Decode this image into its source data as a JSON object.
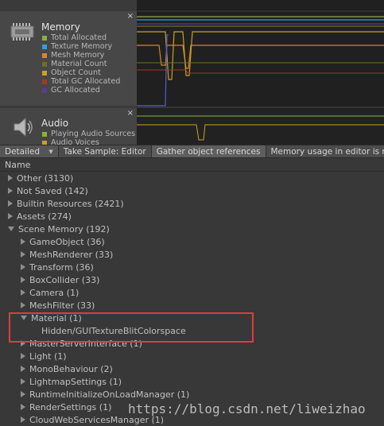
{
  "modules": {
    "memory": {
      "title": "Memory",
      "close": "×",
      "legend": [
        {
          "label": "Total Allocated",
          "color": "#8bb040"
        },
        {
          "label": "Texture Memory",
          "color": "#3a9bd0"
        },
        {
          "label": "Mesh Memory",
          "color": "#d6862a"
        },
        {
          "label": "Material Count",
          "color": "#6e6e2a"
        },
        {
          "label": "Object Count",
          "color": "#c8a21c"
        },
        {
          "label": "Total GC Allocated",
          "color": "#a0382e"
        },
        {
          "label": "GC Allocated",
          "color": "#5a3d8f"
        }
      ]
    },
    "audio": {
      "title": "Audio",
      "close": "×",
      "legend": [
        {
          "label": "Playing Audio Sources",
          "color": "#8bb040"
        },
        {
          "label": "Audio Voices",
          "color": "#c8a21c"
        }
      ]
    }
  },
  "toolbar": {
    "view_mode": "Detailed",
    "take_sample": "Take Sample: Editor",
    "gather_refs": "Gather object references",
    "info": "Memory usage in editor is not"
  },
  "tree": {
    "header": "Name",
    "rows": [
      {
        "label": "Other (3130)",
        "depth": 0,
        "state": "collapsed"
      },
      {
        "label": "Not Saved (142)",
        "depth": 0,
        "state": "collapsed"
      },
      {
        "label": "Builtin Resources (2421)",
        "depth": 0,
        "state": "collapsed"
      },
      {
        "label": "Assets (274)",
        "depth": 0,
        "state": "collapsed"
      },
      {
        "label": "Scene Memory (192)",
        "depth": 0,
        "state": "expanded"
      },
      {
        "label": "GameObject (36)",
        "depth": 1,
        "state": "collapsed"
      },
      {
        "label": "MeshRenderer (33)",
        "depth": 1,
        "state": "collapsed"
      },
      {
        "label": "Transform (36)",
        "depth": 1,
        "state": "collapsed"
      },
      {
        "label": "BoxCollider (33)",
        "depth": 1,
        "state": "collapsed"
      },
      {
        "label": "Camera (1)",
        "depth": 1,
        "state": "collapsed"
      },
      {
        "label": "MeshFilter (33)",
        "depth": 1,
        "state": "collapsed"
      },
      {
        "label": "Material (1)",
        "depth": 1,
        "state": "expanded"
      },
      {
        "label": "Hidden/GUITextureBlitColorspace",
        "depth": 2,
        "state": "leaf"
      },
      {
        "label": "MasterServerInterface (1)",
        "depth": 1,
        "state": "collapsed"
      },
      {
        "label": "Light (1)",
        "depth": 1,
        "state": "collapsed"
      },
      {
        "label": "MonoBehaviour (2)",
        "depth": 1,
        "state": "collapsed"
      },
      {
        "label": "LightmapSettings (1)",
        "depth": 1,
        "state": "collapsed"
      },
      {
        "label": "RuntimeInitializeOnLoadManager (1)",
        "depth": 1,
        "state": "collapsed"
      },
      {
        "label": "RenderSettings (1)",
        "depth": 1,
        "state": "collapsed"
      },
      {
        "label": "CloudWebServicesManager (1)",
        "depth": 1,
        "state": "collapsed"
      }
    ]
  },
  "watermark": "https://blog.csdn.net/liweizhao",
  "colors": {
    "highlight": "#e23b3b",
    "graph_bg": "#202020"
  }
}
